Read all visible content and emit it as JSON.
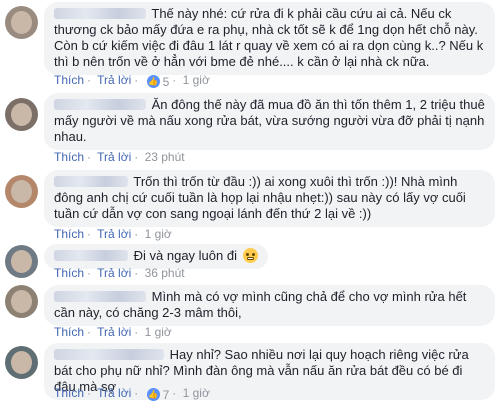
{
  "comments": [
    {
      "text": "Thế này nhé: cứ rửa đi k phải cầu cứu ai cả. Nếu ck thương ck bảo mấy đứa e ra phụ, nhà ck tốt sẽ k để 1ng dọn hết chỗ này. Còn b cứ kiếm việc đi đâu 1 lát r quay về xem có ai ra dọn cùng k..? Nếu k thì b nên trốn về ở hẳn với bme đẻ nhé.... k cần ở lại nhà ck nữa.",
      "like": "Thích",
      "reply": "Trả lời",
      "reactions": "5",
      "time": "1 giờ"
    },
    {
      "text": "Ăn đông thế này đã mua đồ ăn thì tốn thêm 1, 2 triệu thuê mấy người về mà nấu xong rửa bát, vừa sướng người vừa đỡ phải tị nạnh nhau.",
      "like": "Thích",
      "reply": "Trả lời",
      "time": "23 phút"
    },
    {
      "text": "Trốn thì trốn từ đầu :)) ai xong xuôi thì trốn :))! Nhà mình đông anh chị cứ cuối tuần là họp lại nhậu nhẹt:)) sau này có lấy vợ cuối tuần cứ dẫn vợ con sang ngoại lánh đến thứ 2 lại về :))",
      "like": "Thích",
      "reply": "Trả lời",
      "time": "1 giờ"
    },
    {
      "text": "Đi và ngay luôn đi",
      "like": "Thích",
      "reply": "Trả lời",
      "time": "36 phút"
    },
    {
      "text": "Mình mà có vợ mình cũng chả để cho vợ mình rửa hết cần này, có chăng 2-3 mâm thôi,",
      "like": "Thích",
      "reply": "Trả lời",
      "time": "1 giờ"
    },
    {
      "text": "Hay nhỉ? Sao nhiều nơi lại quy hoạch riêng việc rửa bát cho phụ nữ nhỉ? Mình đàn ông mà vẫn nấu ăn rửa bát đều có bé đi đâu mà sợ",
      "like": "Thích",
      "reply": "Trả lời",
      "reactions": "7",
      "time": "1 giờ"
    }
  ],
  "icons": {
    "like": "like-thumb-icon",
    "emoji": "emoji-icon"
  },
  "colors": {
    "bubble": "#f2f3f5",
    "link": "#4267b2",
    "meta": "#90949c",
    "like_badge": "#5890ff"
  }
}
